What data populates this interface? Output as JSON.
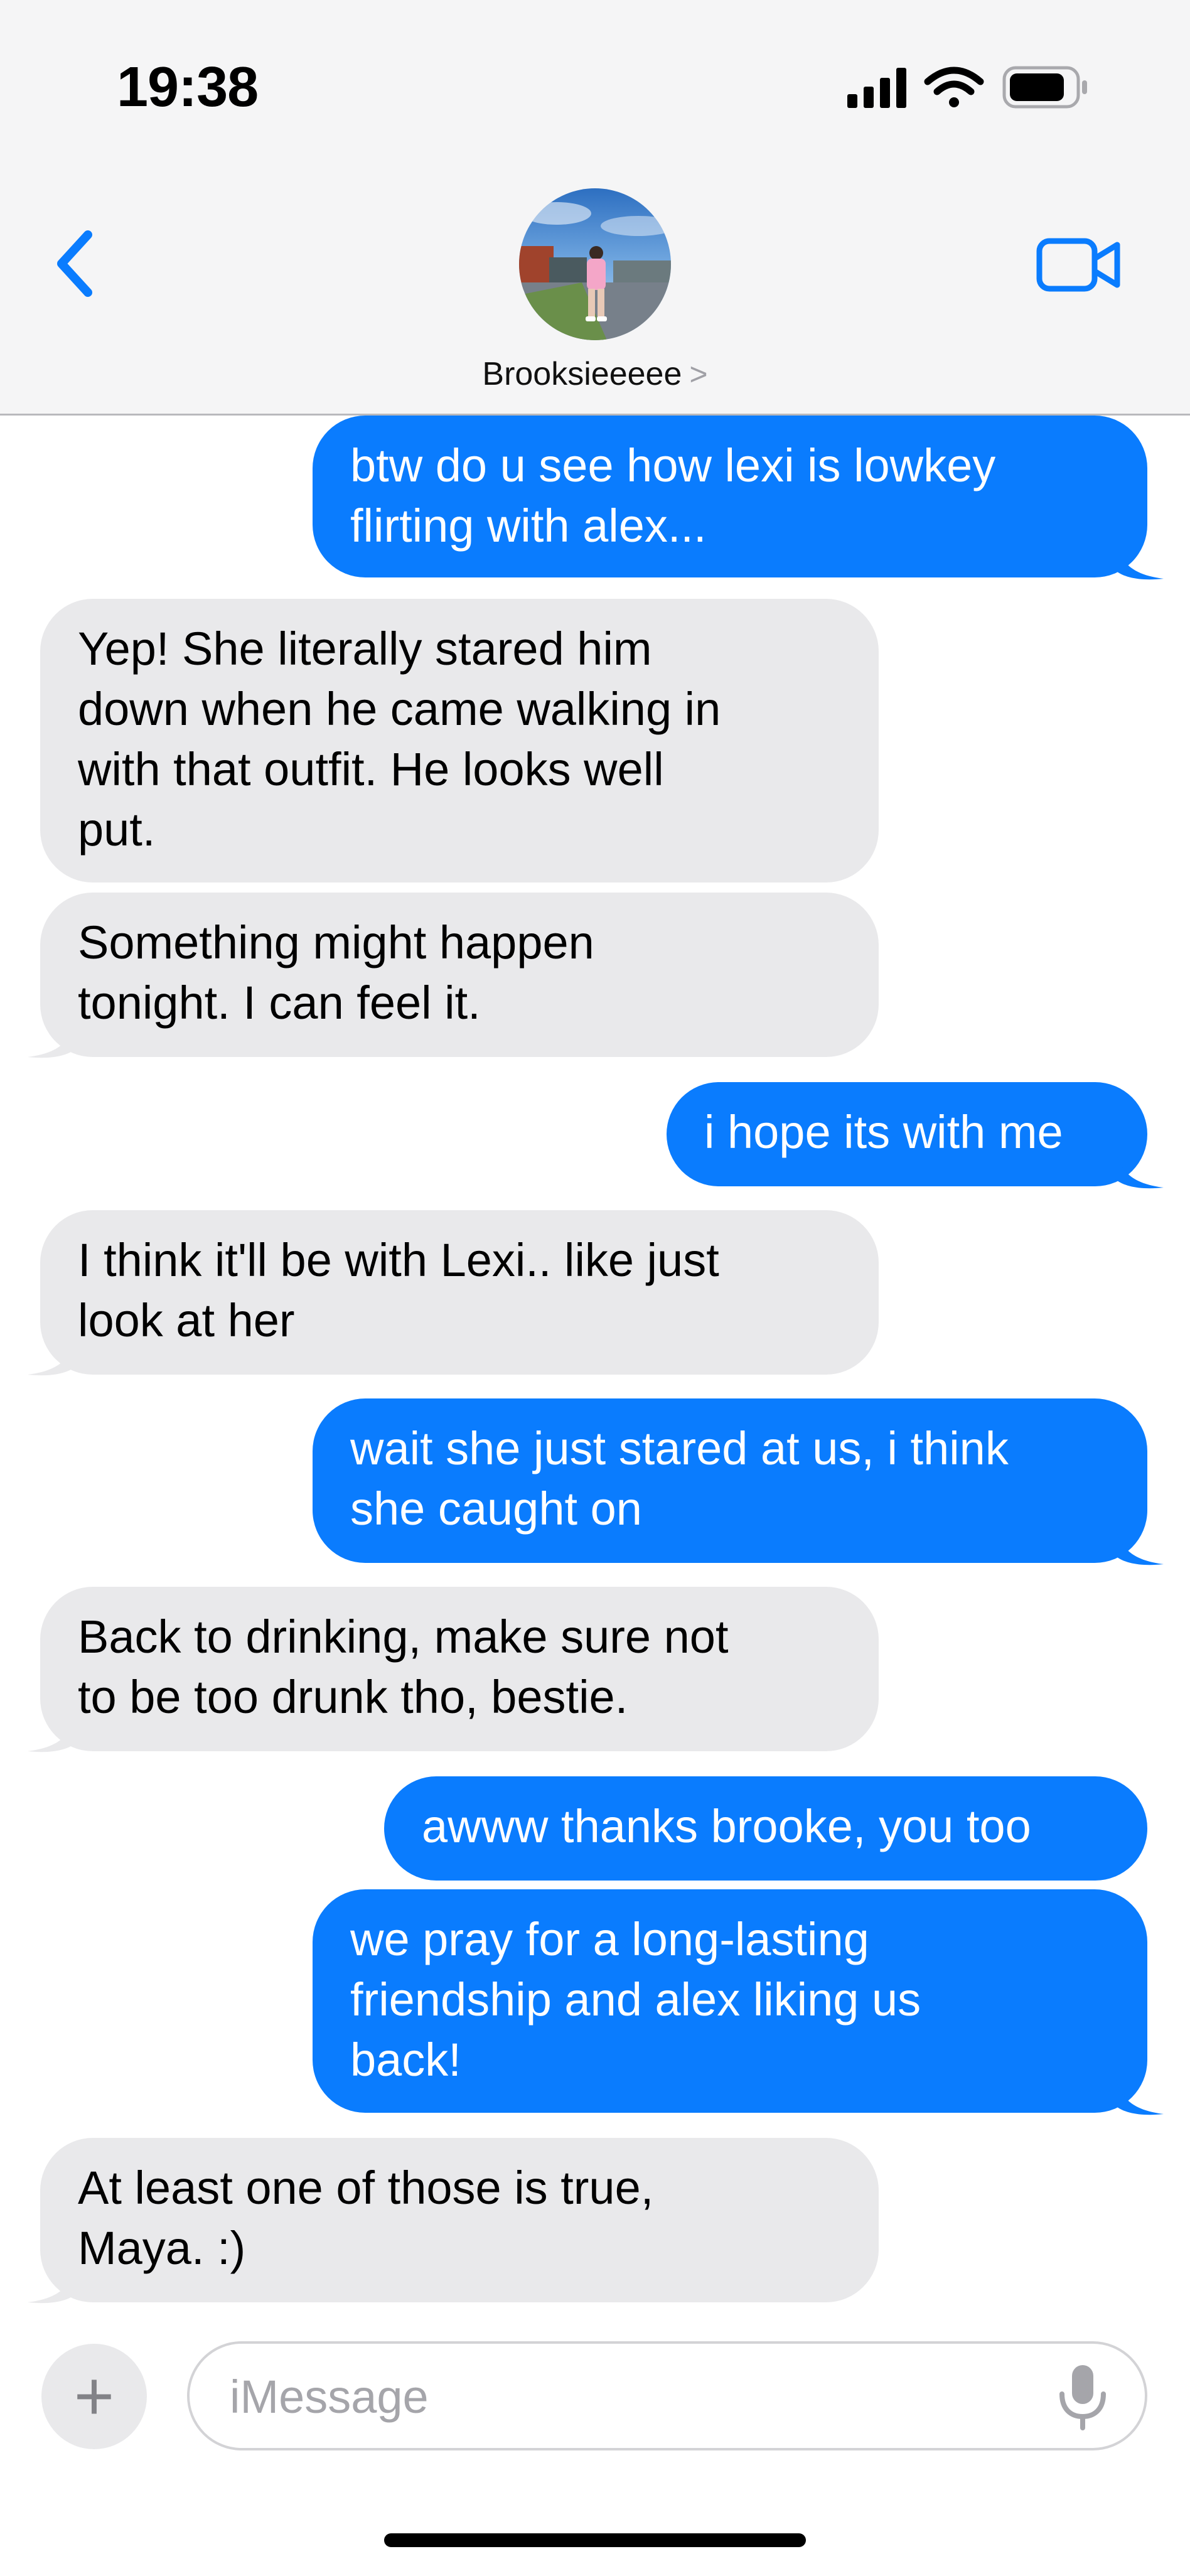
{
  "status_bar": {
    "time": "19:38",
    "icons": [
      "cellular-signal-icon",
      "wifi-icon",
      "battery-icon"
    ]
  },
  "header": {
    "back_icon": "chevron-left-icon",
    "contact_name": "Brooksieeeee",
    "contact_chevron": ">",
    "video_icon": "video-camera-icon",
    "accent_color": "#0a7cfe"
  },
  "messages": [
    {
      "from": "me",
      "text": "btw do u see how lexi is lowkey\nflirting with alex..."
    },
    {
      "from": "them",
      "text": "Yep! She literally stared him\ndown when he came walking in\nwith that outfit. He looks well\nput."
    },
    {
      "from": "them",
      "text": "Something might happen\ntonight. I can feel it."
    },
    {
      "from": "me",
      "text": "i hope its with me"
    },
    {
      "from": "them",
      "text": "I think it'll be with Lexi.. like just\nlook at her"
    },
    {
      "from": "me",
      "text": "wait she just stared at us, i think\nshe caught on"
    },
    {
      "from": "them",
      "text": "Back to drinking, make sure not\nto be too drunk tho, bestie."
    },
    {
      "from": "me",
      "text": "awww thanks brooke, you too"
    },
    {
      "from": "me",
      "text": "we pray for a long-lasting\nfriendship and alex liking us\nback!"
    },
    {
      "from": "them",
      "text": "At least one of those is true,\nMaya. :)"
    }
  ],
  "composer": {
    "plus_label": "+",
    "placeholder": "iMessage",
    "value": "",
    "mic_icon": "microphone-icon"
  },
  "colors": {
    "outgoing_bubble": "#0a7cfe",
    "incoming_bubble": "#e9e9eb"
  }
}
